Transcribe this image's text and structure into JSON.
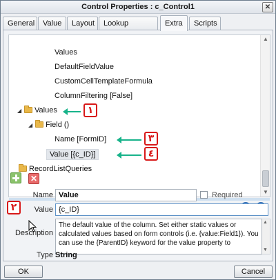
{
  "window": {
    "title": "Control Properties : c_Control1",
    "close_glyph": "✕"
  },
  "tabs": [
    {
      "label": "General"
    },
    {
      "label": "Value"
    },
    {
      "label": "Layout"
    },
    {
      "label": "Lookup Details"
    },
    {
      "label": "Extra",
      "active": true
    },
    {
      "label": "Scripts"
    }
  ],
  "tree": {
    "items": [
      {
        "label": "Values"
      },
      {
        "label": "DefaultFieldValue"
      },
      {
        "label": "CustomCellTemplateFormula"
      },
      {
        "label": "ColumnFiltering [False]"
      },
      {
        "label": "Values",
        "folder": true,
        "expander": "◢"
      },
      {
        "label": "Field ()",
        "folder": true,
        "expander": "◢"
      },
      {
        "label": "Name [FormID]"
      },
      {
        "label": "Value [{c_ID}]",
        "selected": true
      },
      {
        "label": "RecordListQueries",
        "folder": true
      }
    ]
  },
  "annotations": [
    {
      "label": "١"
    },
    {
      "label": "٢"
    },
    {
      "label": "٣"
    },
    {
      "label": "٤"
    }
  ],
  "toolbar": {
    "delete_glyph": "✕",
    "up_glyph": "▲",
    "down_glyph": "▼"
  },
  "properties": {
    "name_label": "Name",
    "name_value": "Value",
    "required_label": "Required",
    "value_label": "Value",
    "value_value": "{c_ID}",
    "description_label": "Description",
    "description_text": "The default value of the column. Set either static values or calculated values based on form controls (i.e. {value:Field1}). You can use the {ParentID} keyword for the value property to",
    "type_label": "Type",
    "type_value": "String"
  },
  "buttons": {
    "ok": "OK",
    "cancel": "Cancel"
  },
  "colors": {
    "annotation": "#d81818",
    "arrow": "#17b38a",
    "add": "#8ac26b",
    "delete": "#e96b6b"
  }
}
